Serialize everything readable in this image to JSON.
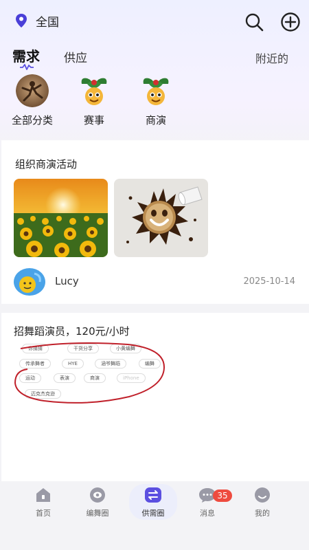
{
  "header": {
    "location": "全国",
    "icons": [
      "location-pin-icon",
      "search-icon",
      "add-circle-icon"
    ]
  },
  "tabs": {
    "demand": "需求",
    "supply": "供应",
    "nearby": "附近的",
    "active": "demand"
  },
  "categories": [
    {
      "label": "全部分类",
      "icon": "all-categories-icon"
    },
    {
      "label": "赛事",
      "icon": "event-icon"
    },
    {
      "label": "商演",
      "icon": "commercial-show-icon"
    }
  ],
  "posts": [
    {
      "title": "组织商演活动",
      "images": [
        "sunflower-field-photo",
        "coffee-splash-smiley-photo"
      ],
      "author": "Lucy",
      "date": "2025-10-14"
    },
    {
      "title": "招舞蹈演员，120元/小时",
      "tags": [
        "你猜猜",
        "干货分享",
        "小黄编舞",
        "传承舞者",
        "HYE",
        "涵爷舞蹈",
        "编舞",
        "运动",
        "表演",
        "商演",
        "iPhone",
        "迈克杰克逊"
      ]
    }
  ],
  "nav": {
    "items": [
      {
        "label": "首页",
        "icon": "home-icon"
      },
      {
        "label": "编舞圈",
        "icon": "eye-circle-icon"
      },
      {
        "label": "供需圈",
        "icon": "exchange-icon"
      },
      {
        "label": "消息",
        "icon": "chat-icon"
      },
      {
        "label": "我的",
        "icon": "profile-icon"
      }
    ],
    "active": "供需圈",
    "message_badge": "35"
  },
  "colors": {
    "accent": "#5b4fe0",
    "badge": "#ee4b3f",
    "tag_circle": "#c0202a"
  }
}
